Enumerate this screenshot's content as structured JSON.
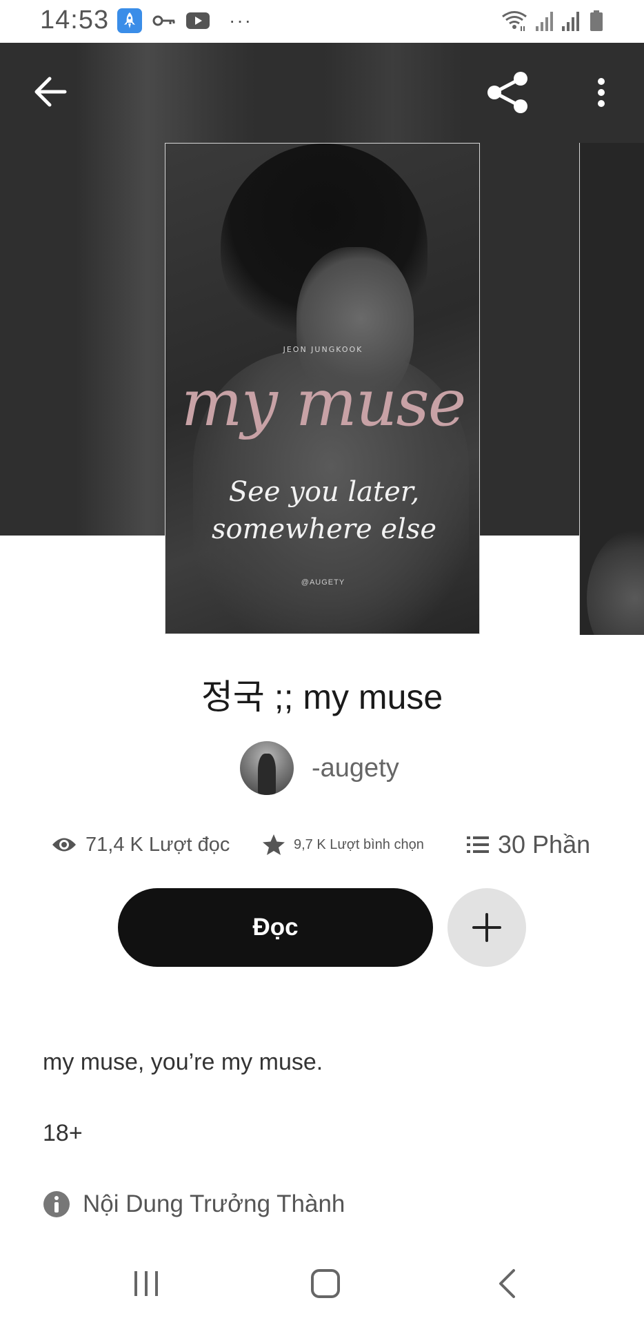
{
  "status_bar": {
    "time": "14:53",
    "icons": [
      "rocket-app-icon",
      "key-icon",
      "youtube-icon",
      "more-dots-icon",
      "wifi-icon",
      "signal-icon",
      "signal-icon",
      "battery-icon"
    ],
    "more": "···"
  },
  "header": {
    "back_icon": "arrow-left-icon",
    "share_icon": "share-icon",
    "menu_icon": "more-vertical-icon"
  },
  "cover": {
    "kicker": "JEON JUNGKOOK",
    "title": "my muse",
    "subtitle": "See you later, somewhere else",
    "author": "@AUGETY"
  },
  "story": {
    "title": "정국 ;; my muse",
    "author": "-augety"
  },
  "stats": {
    "reads": "71,4 K Lượt đọc",
    "votes": "9,7 K Lượt bình chọn",
    "parts": "30 Phần"
  },
  "actions": {
    "read_label": "Đọc",
    "add_icon": "plus-icon"
  },
  "description": {
    "line1": "my muse, you’re my muse.",
    "line2": "18+",
    "mature_label": "Nội Dung Trưởng Thành"
  },
  "colors": {
    "hero_bg": "#2f2f2f",
    "read_button": "#111111",
    "add_button": "#e2e2e2",
    "cover_title": "#c8a2a6"
  }
}
